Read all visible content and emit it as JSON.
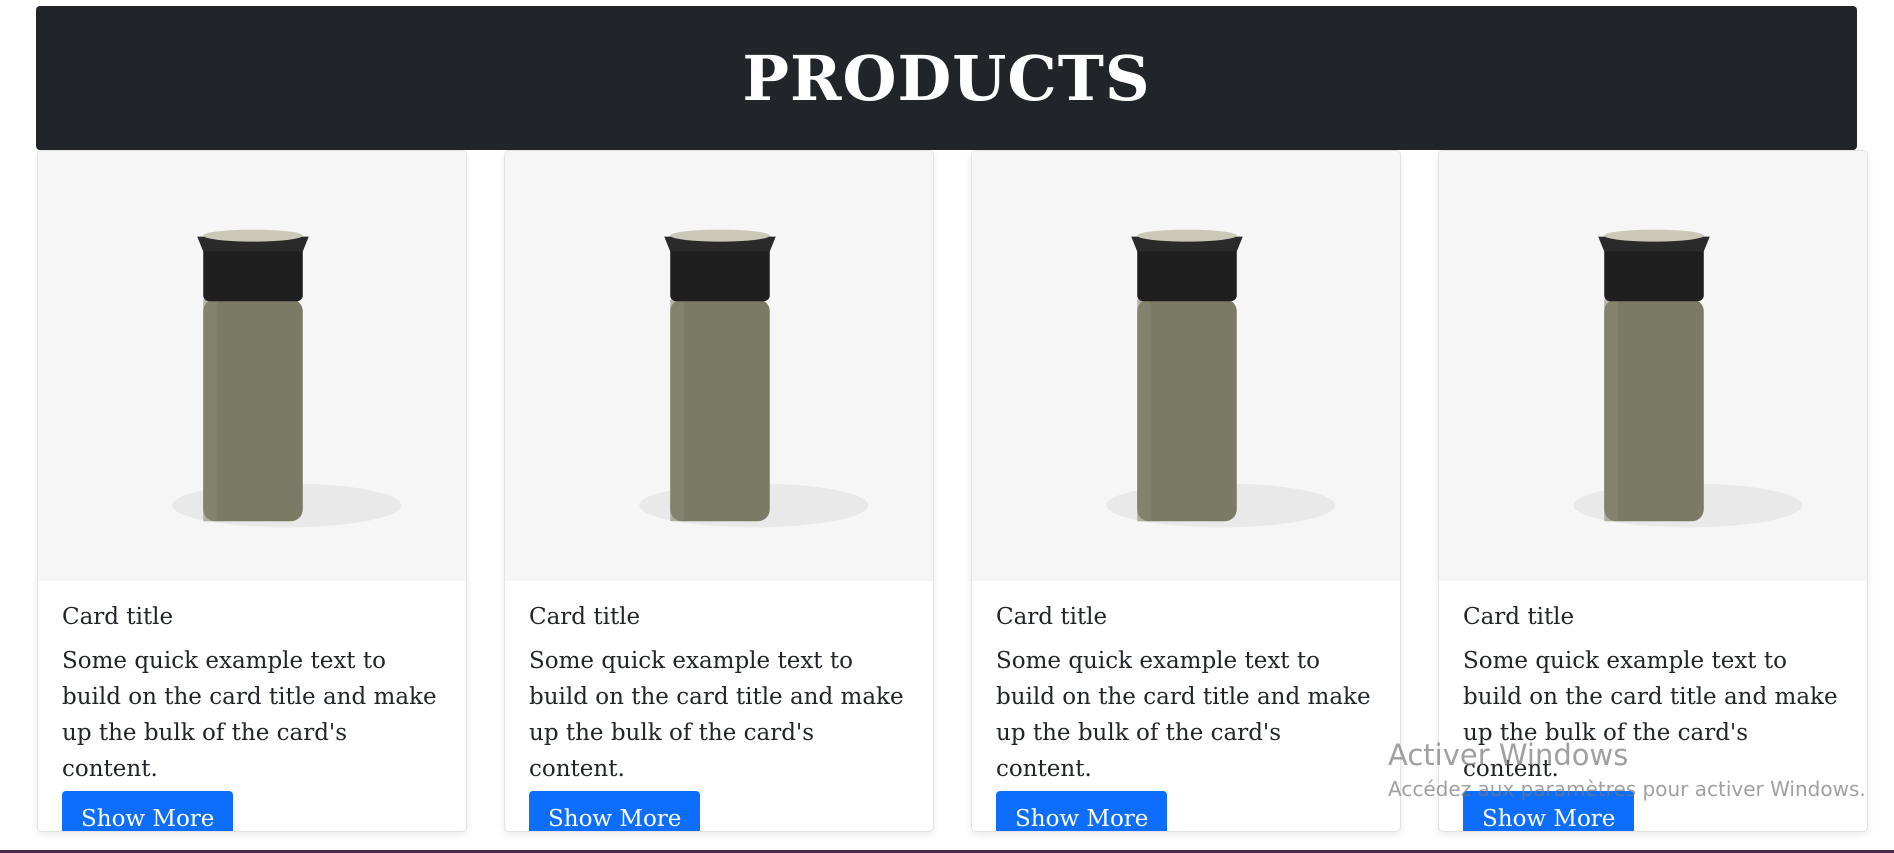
{
  "header": {
    "title": "PRODUCTS"
  },
  "cards": [
    {
      "title": "Card title",
      "text": "Some quick example text to build on the card title and make up the bulk of the card's content.",
      "button": "Show More"
    },
    {
      "title": "Card title",
      "text": "Some quick example text to build on the card title and make up the bulk of the card's content.",
      "button": "Show More"
    },
    {
      "title": "Card title",
      "text": "Some quick example text to build on the card title and make up the bulk of the card's content.",
      "button": "Show More"
    },
    {
      "title": "Card title",
      "text": "Some quick example text to build on the card title and make up the bulk of the card's content.",
      "button": "Show More"
    }
  ],
  "watermark": {
    "line1": "Activer Windows",
    "line2": "Accédez aux paramètres pour activer Windows."
  },
  "colors": {
    "header_bg": "#212529",
    "button_bg": "#0d6efd",
    "image_bg": "#f6f6f6"
  }
}
